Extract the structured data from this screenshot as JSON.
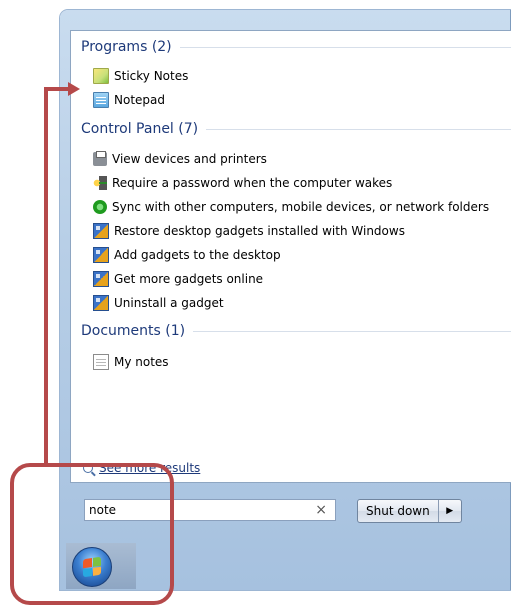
{
  "programs": {
    "header": "Programs (2)",
    "items": [
      {
        "label": "Sticky Notes",
        "icon": "sticky-notes-icon"
      },
      {
        "label": "Notepad",
        "icon": "notepad-icon"
      }
    ]
  },
  "control_panel": {
    "header": "Control Panel (7)",
    "items": [
      {
        "label": "View devices and printers",
        "icon": "printer-icon"
      },
      {
        "label": "Require a password when the computer wakes",
        "icon": "key-icon"
      },
      {
        "label": "Sync with other computers, mobile devices, or network folders",
        "icon": "sync-icon"
      },
      {
        "label": "Restore desktop gadgets installed with Windows",
        "icon": "gadget-icon"
      },
      {
        "label": "Add gadgets to the desktop",
        "icon": "gadget-icon"
      },
      {
        "label": "Get more gadgets online",
        "icon": "gadget-icon"
      },
      {
        "label": "Uninstall a gadget",
        "icon": "gadget-icon"
      }
    ]
  },
  "documents": {
    "header": "Documents (1)",
    "items": [
      {
        "label": "My notes",
        "icon": "document-icon"
      }
    ]
  },
  "see_more": "See more results",
  "search": {
    "value": "note",
    "clear_symbol": "×"
  },
  "shutdown": {
    "label": "Shut down",
    "arrow": "▶"
  },
  "colors": {
    "annotation": "#b5494a",
    "header_text": "#1e3a7a"
  }
}
